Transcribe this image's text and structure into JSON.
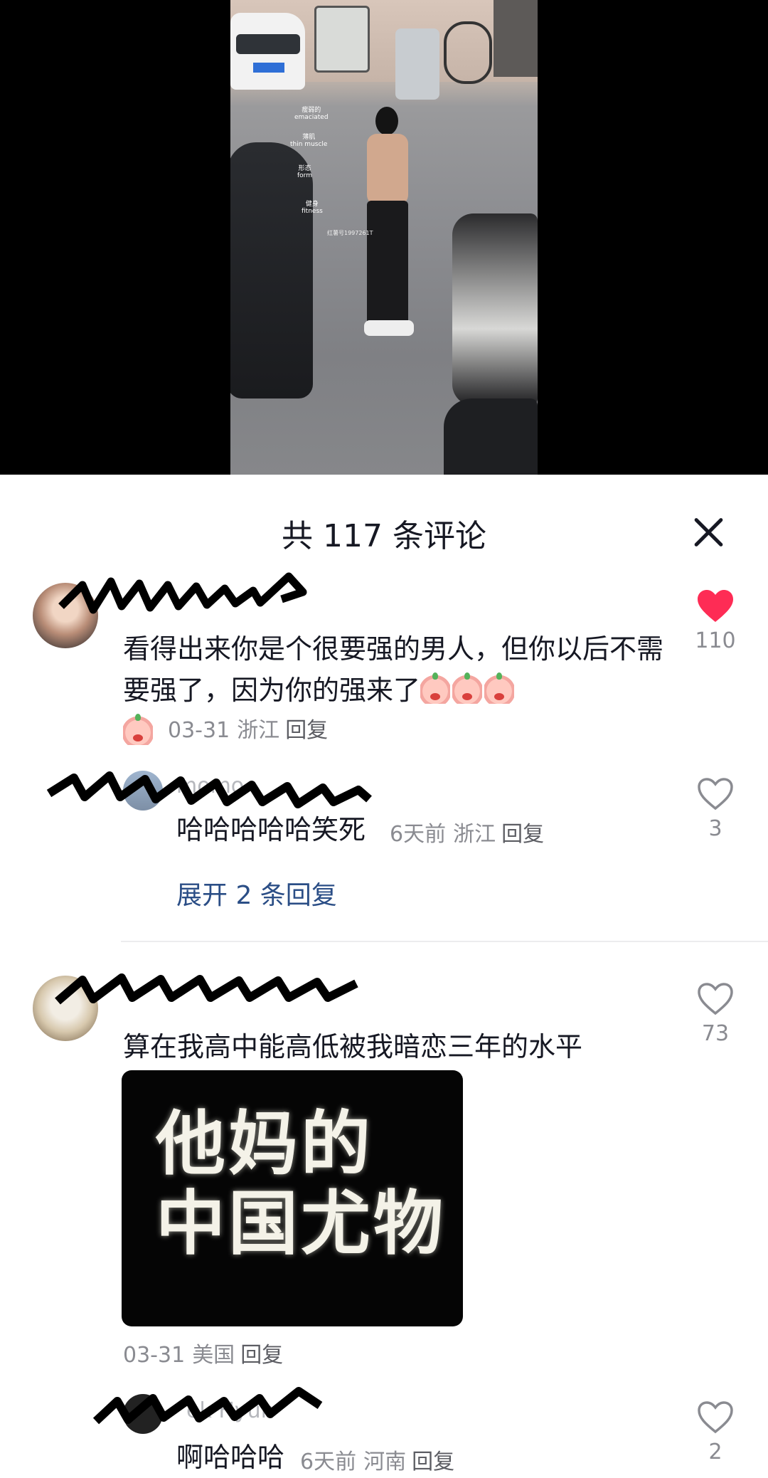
{
  "video": {
    "overlay_labels": [
      {
        "cn": "瘦弱的",
        "en": "emaciated"
      },
      {
        "cn": "薄肌",
        "en": "thin muscle"
      },
      {
        "cn": "形态",
        "en": "form"
      },
      {
        "cn": "健身",
        "en": "fitness"
      }
    ],
    "watermark": "红薯号1997261T"
  },
  "header": {
    "title": "共 117 条评论"
  },
  "comments": [
    {
      "text": "看得出来你是个很要强的男人，但你以后不需要强了，因为你的强来了",
      "date": "03-31",
      "region": "浙江",
      "reply_label": "回复",
      "likes": "110",
      "liked": true,
      "emoji_count": 4
    },
    {
      "username_fragment": "momo",
      "text": "哈哈哈哈哈笑死",
      "date": "6天前",
      "region": "浙江",
      "reply_label": "回复",
      "likes": "3",
      "liked": false,
      "expand_label": "展开 2 条回复"
    },
    {
      "text": "算在我高中能高低被我暗恋三年的水平",
      "image_text": [
        "他妈的",
        "中国尤物"
      ],
      "date": "03-31",
      "region": "美国",
      "reply_label": "回复",
      "likes": "73",
      "liked": false
    },
    {
      "username_fragment": "ek Hyun",
      "text": "啊哈哈哈",
      "date": "6天前",
      "region": "河南",
      "reply_label": "回复",
      "likes": "2",
      "liked": false
    }
  ],
  "colors": {
    "like_active": "#FE2C55",
    "link": "#2B4E86",
    "muted": "#8A8B91"
  },
  "icons": {
    "close": "close-icon",
    "heart_filled": "heart-filled-icon",
    "heart_outline": "heart-outline-icon"
  }
}
